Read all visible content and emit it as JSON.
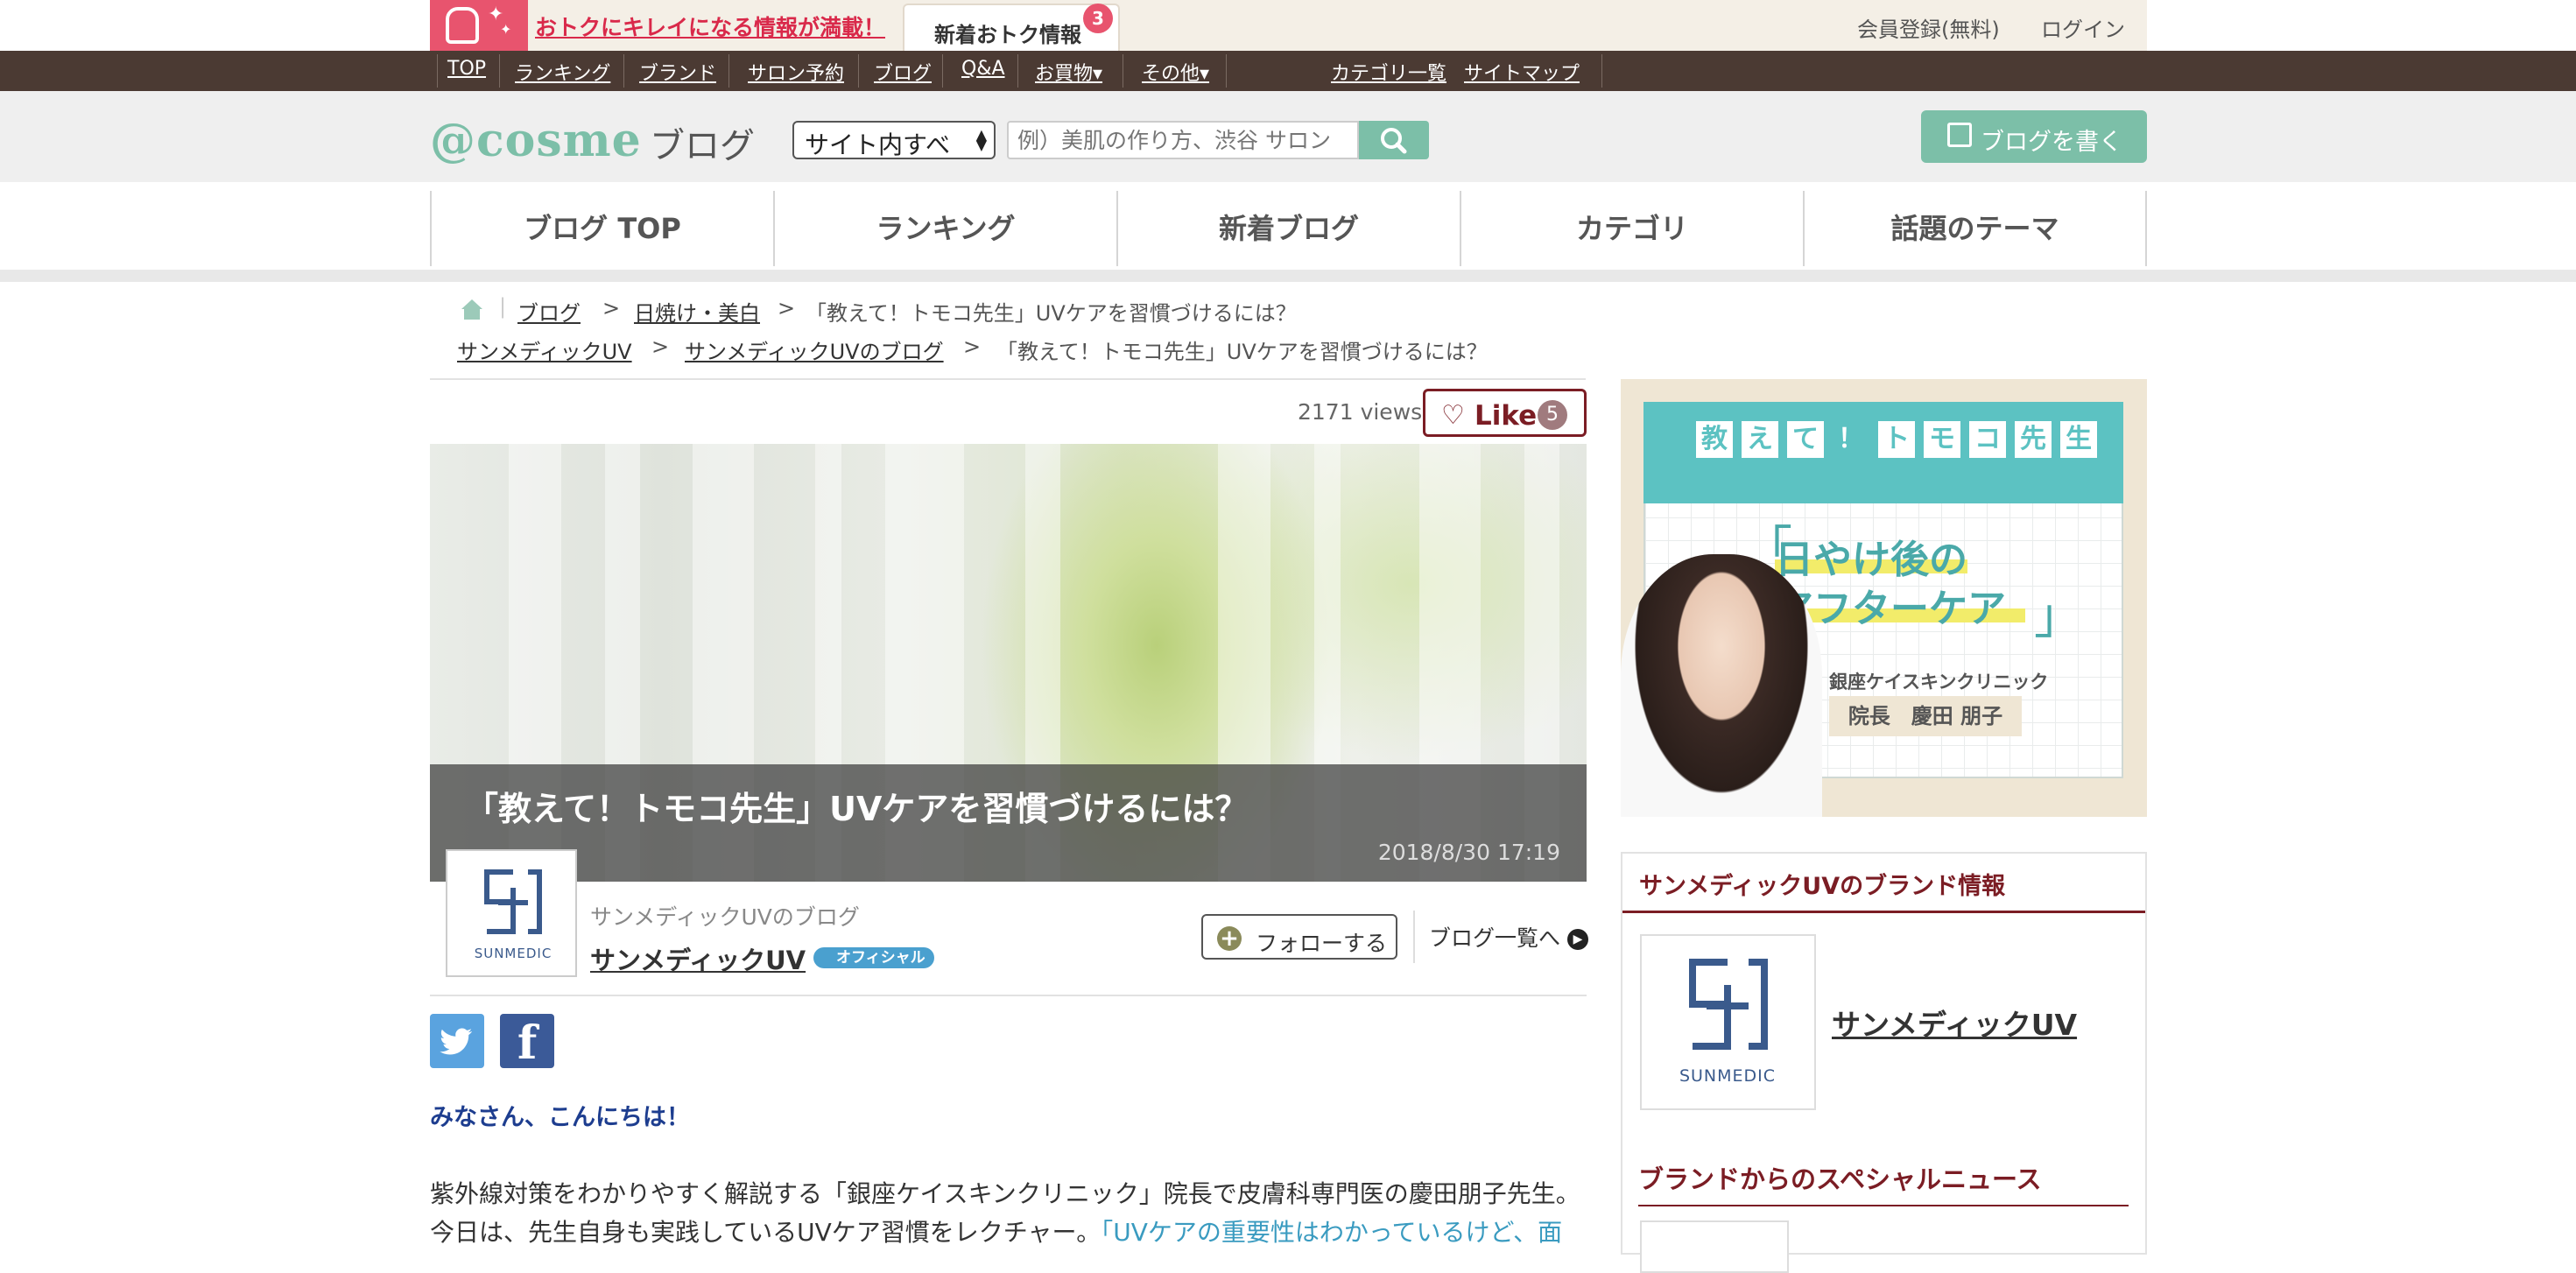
{
  "topbar": {
    "promo_text": "おトクにキレイになる情報が満載！",
    "new_tab_label": "新着おトク情報",
    "new_tab_badge": "3",
    "register": "会員登録(無料)",
    "login": "ログイン"
  },
  "darknav": {
    "items": [
      "TOP",
      "ランキング",
      "ブランド",
      "サロン予約",
      "ブログ",
      "Q&A",
      "お買物▾",
      "その他▾"
    ],
    "right_items": [
      "カテゴリ一覧",
      "サイトマップ"
    ]
  },
  "header": {
    "logo": "@cosme",
    "logo_sub": "ブログ",
    "select_value": "サイト内すべ",
    "search_placeholder": "例）美肌の作り方、渋谷 サロン",
    "write_button": "ブログを書く"
  },
  "tabs": [
    "ブログ TOP",
    "ランキング",
    "新着ブログ",
    "カテゴリ",
    "話題のテーマ"
  ],
  "breadcrumb": {
    "row1": [
      "ブログ",
      "日焼け・美白",
      "「教えて！トモコ先生」UVケアを習慣づけるには？"
    ],
    "row2": [
      "サンメディックUV",
      "サンメディックUVのブログ",
      "「教えて！トモコ先生」UVケアを習慣づけるには？"
    ],
    "sep": ">"
  },
  "article": {
    "views": "2171 views",
    "like_label": "Like",
    "like_count": "5",
    "title": "「教えて！トモコ先生」UVケアを習慣づけるには？",
    "date": "2018/8/30 17:19",
    "author_blog": "サンメディックUVのブログ",
    "author_name": "サンメディックUV",
    "official_badge": "オフィシャル",
    "follow": "フォローする",
    "blog_list": "ブログ一覧へ",
    "logo_text": "SUNMEDIC",
    "greeting": "みなさん、こんにちは！",
    "body_line1": "紫外線対策をわかりやすく解説する「銀座ケイスキンクリニック」院長で皮膚科専門医の慶田朋子先生。",
    "body_line2_a": "今日は、先生自身も実践しているUVケア習慣をレクチャー。",
    "body_line2_link": "「UVケアの重要性はわかっているけど、面"
  },
  "banner": {
    "title_chars": [
      "教",
      "え",
      "て",
      "！",
      "ト",
      "モ",
      "コ",
      "先",
      "生"
    ],
    "headline1": "日やけ後の",
    "headline2": "アフターケア",
    "clinic": "銀座ケイスキンクリニック",
    "doctor": "院長　慶田 朋子"
  },
  "sidebar": {
    "brand_heading": "サンメディックUVのブランド情報",
    "brand_name": "サンメディックUV",
    "brand_logo_text": "SUNMEDIC",
    "news_heading": "ブランドからのスペシャルニュース"
  },
  "colors": {
    "accent_green": "#7cbfa8",
    "maroon": "#7b1d24",
    "promo_red": "#e8546e",
    "nav_brown": "#4b3a33"
  }
}
